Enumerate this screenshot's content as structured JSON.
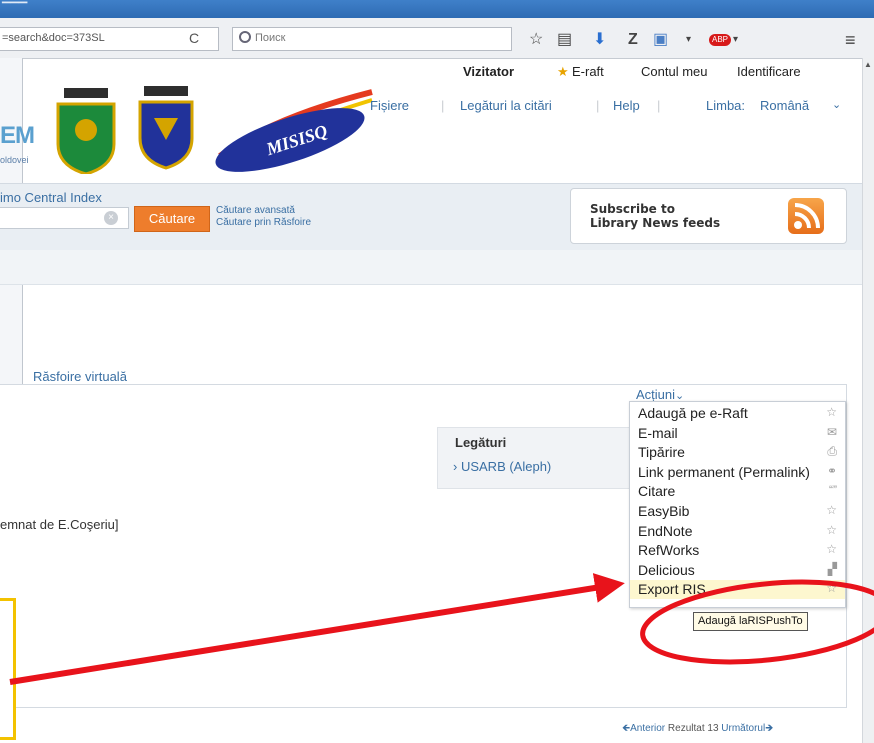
{
  "browser": {
    "url_text": "=search&doc=373SL",
    "search_placeholder": "Поиск",
    "reload_symbol": "C",
    "toolbar_icons": [
      "star-icon",
      "reading-list-icon",
      "download-icon",
      "zotero-icon",
      "screen-icon",
      "adblock-icon",
      "menu-icon"
    ],
    "abp_text": "ABP",
    "zotero_text": "Z"
  },
  "header": {
    "top_nav": {
      "visitor": "Vizitator",
      "eraft": "E-raft",
      "account": "Contul meu",
      "login": "Identificare"
    },
    "second_nav": {
      "fisiere": "Fișiere",
      "citations": "Legături la citări",
      "help": "Help",
      "language_label": "Limba:",
      "language_value": "Română"
    },
    "logo_text": "EM",
    "logo_sub": "oldovei",
    "misisq_text": "MISISQ"
  },
  "search": {
    "central_index": "imo Central Index",
    "clear_symbol": "×",
    "button_label": "Căutare",
    "advanced_link": "Căutare avansată",
    "browse_link": "Căutare prin Răsfoire"
  },
  "rss": {
    "line1": "Subscribe to",
    "line2": "Library News feeds"
  },
  "content": {
    "virtual_browse": "Răsfoire virtuală",
    "actions_label": "Acțiuni",
    "links_title": "Legături",
    "links_item": "USARB (Aleph)",
    "note_text": "emnat de E.Coşeriu]"
  },
  "actions_menu": [
    {
      "label": "Adaugă pe e-Raft",
      "icon": "star-outline-icon",
      "glyph": "☆"
    },
    {
      "label": "E-mail",
      "icon": "envelope-icon",
      "glyph": "✉"
    },
    {
      "label": "Tipărire",
      "icon": "printer-icon",
      "glyph": "⎙"
    },
    {
      "label": "Link permanent (Permalink)",
      "icon": "link-icon",
      "glyph": "⚭"
    },
    {
      "label": "Citare",
      "icon": "quote-icon",
      "glyph": "“”"
    },
    {
      "label": "EasyBib",
      "icon": "star-outline-icon",
      "glyph": "☆"
    },
    {
      "label": "EndNote",
      "icon": "star-outline-icon",
      "glyph": "☆"
    },
    {
      "label": "RefWorks",
      "icon": "star-outline-icon",
      "glyph": "☆"
    },
    {
      "label": "Delicious",
      "icon": "delicious-icon",
      "glyph": "▞"
    },
    {
      "label": "Export RIS",
      "icon": "star-outline-icon",
      "glyph": "☆"
    }
  ],
  "tooltip": "Adaugă laRISPushTo",
  "pager": {
    "prev": "Anterior",
    "result_label": "Rezultat",
    "result_number": "13",
    "next": "Următorul"
  },
  "colors": {
    "accent": "#3a6fa3",
    "search_button": "#ee7d2c",
    "annotation": "#e8131b",
    "highlight": "#fdf7cf"
  }
}
